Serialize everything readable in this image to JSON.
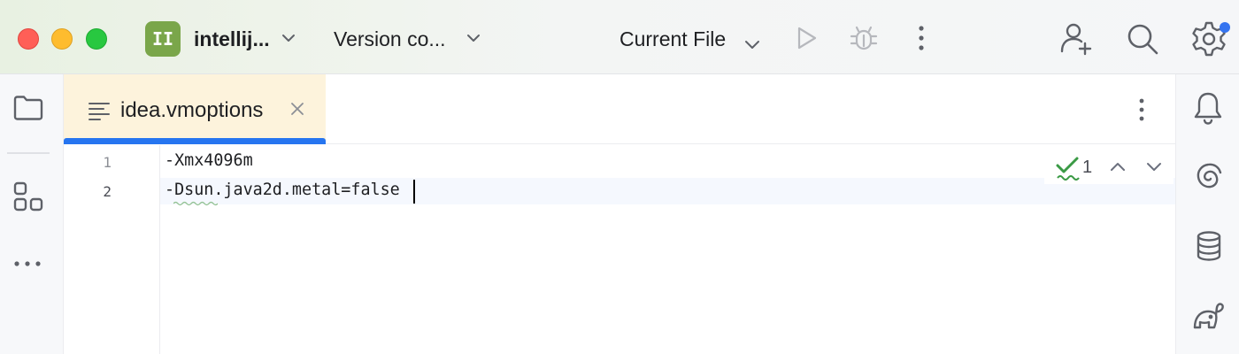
{
  "titlebar": {
    "project_badge": "II",
    "project_name": "intellij...",
    "vcs_label": "Version co...",
    "run_config": "Current File",
    "icons": [
      "chevron-down-icon",
      "run-icon",
      "debug-icon",
      "more-vertical-icon",
      "add-user-icon",
      "search-icon",
      "settings-icon"
    ]
  },
  "left_toolbar": {
    "items": [
      "folder-icon",
      "structure-icon",
      "more-horizontal-icon"
    ]
  },
  "right_toolbar": {
    "items": [
      "notifications-icon",
      "ai-assistant-icon",
      "database-icon",
      "gradle-icon"
    ]
  },
  "editor": {
    "tab": {
      "label": "idea.vmoptions",
      "icon": "text-file-icon"
    },
    "lines": [
      {
        "number": "1",
        "text": "-Xmx4096m"
      },
      {
        "number": "2",
        "text": "-Dsun.java2d.metal=false"
      }
    ],
    "inspection_count": "1"
  },
  "colors": {
    "accent": "#2675f0",
    "tab_active_bg": "#fdf3dc",
    "project_badge": "#7aa64a",
    "notification_dot": "#3574f0",
    "inspection_ok": "#3a9a45"
  }
}
